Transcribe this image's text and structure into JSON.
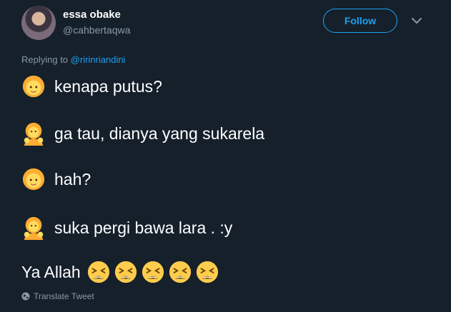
{
  "tweet": {
    "author_name": "essa obake",
    "author_handle": "@cahbertaqwa",
    "follow_label": "Follow",
    "replying_prefix": "Replying to",
    "replying_to": "@ririnriandini",
    "lines": [
      {
        "emoji": "girl-face",
        "text": "kenapa putus?"
      },
      {
        "emoji": "person-raising-hand",
        "text": "ga tau, dianya yang sukarela"
      },
      {
        "emoji": "girl-face",
        "text": "hah?"
      },
      {
        "emoji": "person-raising-hand",
        "text": "suka pergi bawa lara .  :y"
      }
    ],
    "last_line_text": "Ya Allah",
    "last_line_emoji": "tired-face",
    "last_line_emoji_count": 5,
    "translate_label": "Translate Tweet"
  },
  "colors": {
    "background": "#15202b",
    "accent": "#1da1f2",
    "secondary_text": "#8899a6",
    "emoji_yellow": "#ffcc4d"
  }
}
